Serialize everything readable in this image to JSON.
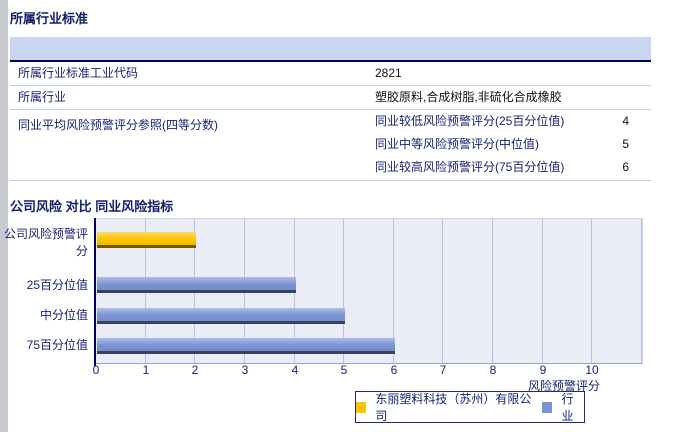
{
  "section_industry": {
    "title": "所属行业标准",
    "table": {
      "header_color": "#c9d6f0",
      "rows": [
        {
          "label": "所属行业标准工业代码",
          "value": "2821"
        },
        {
          "label": "所属行业",
          "value": "塑胶原料,合成树脂,非硫化合成橡胶"
        },
        {
          "label": "同业平均风险预警评分参照(四等分数)"
        }
      ],
      "subrows": [
        {
          "label": "同业较低风险预警评分(25百分位值)",
          "value": "4"
        },
        {
          "label": "同业中等风险预警评分(中位值)",
          "value": "5"
        },
        {
          "label": "同业较高风险预警评分(75百分位值)",
          "value": "6"
        }
      ]
    }
  },
  "section_chart": {
    "title": "公司风险 对比 同业风险指标"
  },
  "chart_data": {
    "type": "bar",
    "orientation": "horizontal",
    "title": "公司风险 对比 同业风险指标",
    "categories": [
      "公司风险预警评分",
      "25百分位值",
      "中分位值",
      "75百分位值"
    ],
    "values": [
      2,
      4,
      5,
      6
    ],
    "bar_colors": [
      "#fdc500",
      "#7b93d4",
      "#7b93d4",
      "#7b93d4"
    ],
    "xlabel": "风险预警评分",
    "x_ticks": [
      0,
      1,
      2,
      3,
      4,
      5,
      6,
      7,
      8,
      9,
      10
    ],
    "xlim": [
      0,
      11
    ],
    "grid": true,
    "grid_color": "#b5c2e2",
    "plot_bg": "#eaedf5",
    "legend_position": "bottom",
    "legend": [
      {
        "label": "东丽塑料科技（苏州）有限公司",
        "color": "#fdc500"
      },
      {
        "label": "行业",
        "color": "#7b93d4"
      }
    ]
  }
}
